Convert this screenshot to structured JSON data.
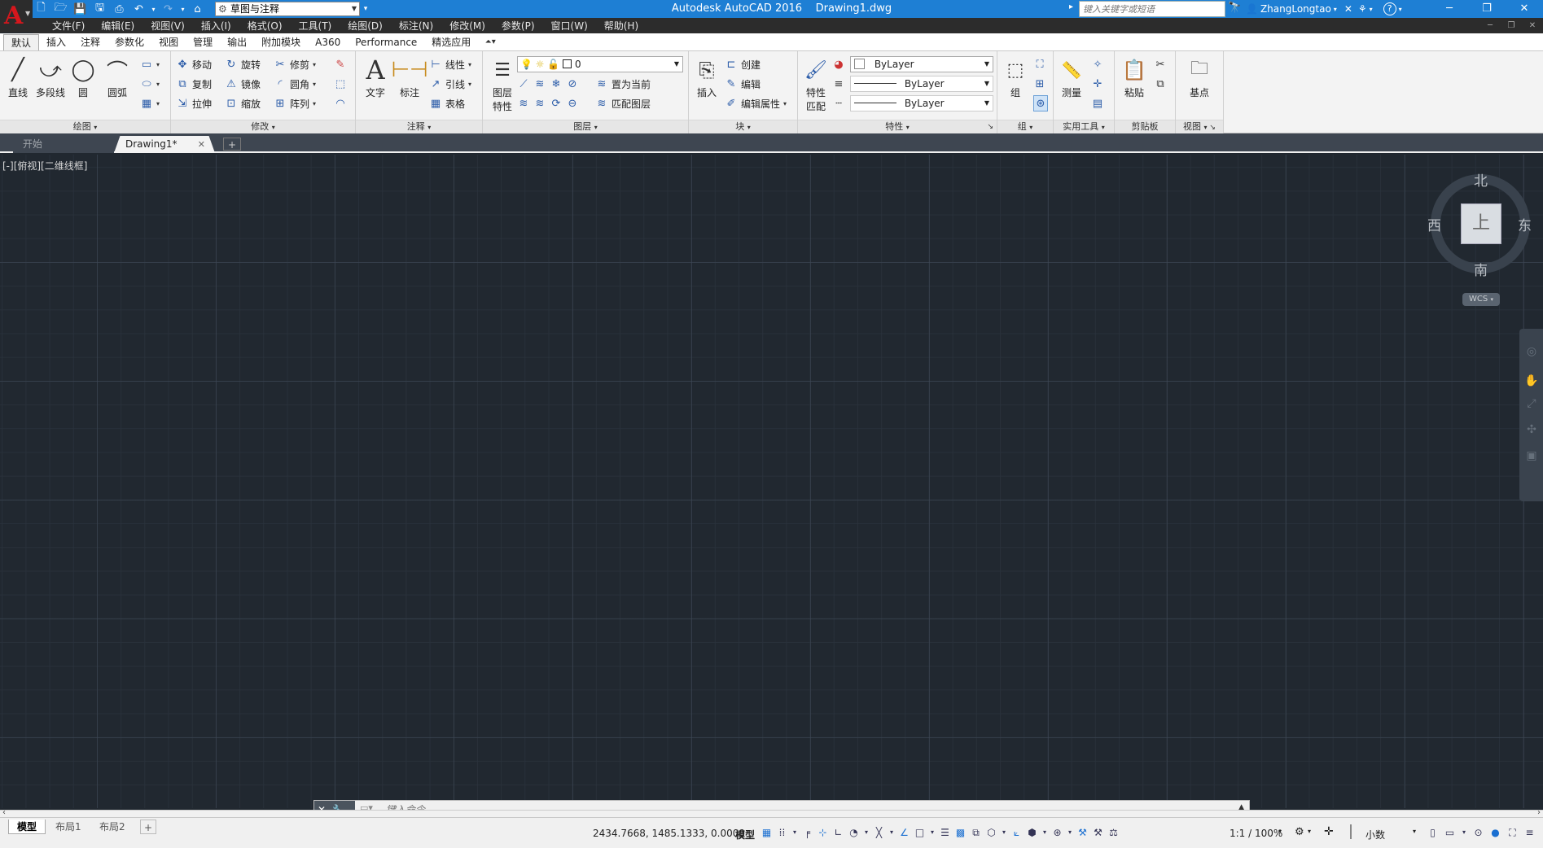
{
  "titlebar": {
    "title": "Autodesk AutoCAD 2016    Drawing1.dwg",
    "workspace": "草图与注释",
    "search_placeholder": "键入关键字或短语",
    "username": "ZhangLongtao",
    "qat_icons": [
      "new-icon",
      "open-icon",
      "save-icon",
      "save-as-icon",
      "print-icon",
      "undo-icon",
      "redo-icon",
      "plot-icon"
    ]
  },
  "menubar": {
    "items": [
      "文件(F)",
      "编辑(E)",
      "视图(V)",
      "插入(I)",
      "格式(O)",
      "工具(T)",
      "绘图(D)",
      "标注(N)",
      "修改(M)",
      "参数(P)",
      "窗口(W)",
      "帮助(H)"
    ]
  },
  "ribbon": {
    "tabs": [
      "默认",
      "插入",
      "注释",
      "参数化",
      "视图",
      "管理",
      "输出",
      "附加模块",
      "A360",
      "Performance",
      "精选应用"
    ],
    "active_tab": "默认",
    "draw": {
      "title": "绘图",
      "line": "直线",
      "polyline": "多段线",
      "circle": "圆",
      "arc": "圆弧"
    },
    "modify": {
      "title": "修改",
      "move": "移动",
      "rotate": "旋转",
      "trim": "修剪",
      "copy": "复制",
      "mirror": "镜像",
      "fillet": "圆角",
      "stretch": "拉伸",
      "scale": "缩放",
      "array": "阵列"
    },
    "annotation": {
      "title": "注释",
      "text": "文字",
      "dimension": "标注",
      "linear": "线性",
      "leader": "引线",
      "table": "表格"
    },
    "layers": {
      "title": "图层",
      "properties_line1": "图层",
      "properties_line2": "特性",
      "current_layer": "0",
      "set_current": "置为当前",
      "match_layer": "匹配图层"
    },
    "block": {
      "title": "块",
      "insert": "插入",
      "create": "创建",
      "edit": "编辑",
      "edit_attributes": "编辑属性"
    },
    "properties": {
      "title": "特性",
      "match_line1": "特性",
      "match_line2": "匹配",
      "color": "ByLayer",
      "linetype": "ByLayer",
      "lineweight": "ByLayer"
    },
    "groups": {
      "title": "组",
      "group": "组"
    },
    "utilities": {
      "title": "实用工具",
      "measure": "测量"
    },
    "clipboard": {
      "title": "剪贴板",
      "paste": "粘贴"
    },
    "view": {
      "title": "视图",
      "base": "基点"
    }
  },
  "file_tabs": {
    "start": "开始",
    "drawing": "Drawing1*",
    "add": "+"
  },
  "viewport": {
    "label": "[-][俯视][二维线框]",
    "viewcube": {
      "north": "北",
      "south": "南",
      "east": "东",
      "west": "西",
      "face": "上",
      "wcs": "WCS"
    }
  },
  "command_line": {
    "placeholder": "键入命令"
  },
  "statusbar": {
    "layout_tabs": [
      "模型",
      "布局1",
      "布局2"
    ],
    "add": "+",
    "coordinates": "2434.7668, 1485.1333, 0.0000",
    "space": "模型",
    "scale": "1:1 / 100%",
    "units": "小数"
  },
  "colors": {
    "titlebar": "#1e7fd4",
    "canvas": "#212830",
    "menubar": "#2c2c2c",
    "logo_red": "#d5171d"
  }
}
